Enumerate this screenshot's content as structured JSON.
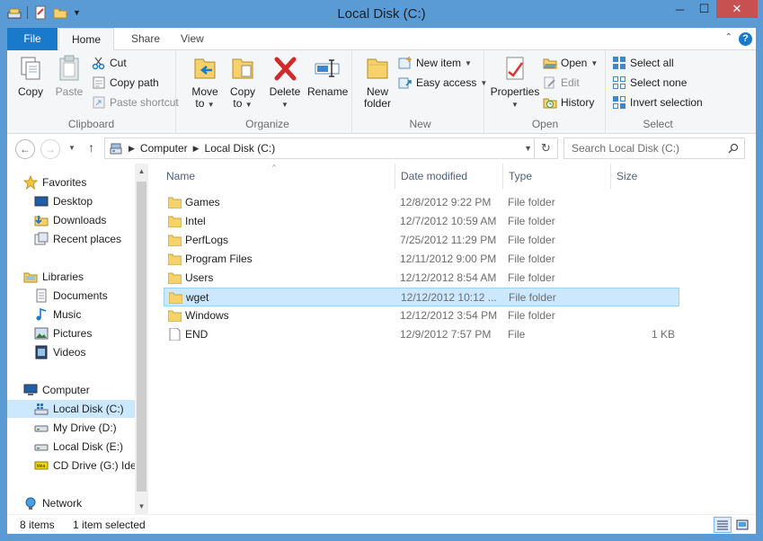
{
  "window": {
    "title": "Local Disk (C:)"
  },
  "ribbon_tabs": {
    "file": "File",
    "home": "Home",
    "share": "Share",
    "view": "View"
  },
  "clipboard": {
    "copy": "Copy",
    "paste": "Paste",
    "cut": "Cut",
    "copy_path": "Copy path",
    "paste_shortcut": "Paste shortcut",
    "label": "Clipboard"
  },
  "organize": {
    "move_to": "Move",
    "move_to_2": "to",
    "copy_to": "Copy",
    "copy_to_2": "to",
    "delete": "Delete",
    "rename": "Rename",
    "label": "Organize"
  },
  "new_group": {
    "new_folder": "New",
    "new_folder_2": "folder",
    "new_item": "New item",
    "easy_access": "Easy access",
    "label": "New"
  },
  "open_group": {
    "properties": "Properties",
    "open": "Open",
    "edit": "Edit",
    "history": "History",
    "label": "Open"
  },
  "select_group": {
    "select_all": "Select all",
    "select_none": "Select none",
    "invert_selection": "Invert selection",
    "label": "Select"
  },
  "address": {
    "computer": "Computer",
    "drive": "Local Disk (C:)"
  },
  "search": {
    "placeholder": "Search Local Disk (C:)"
  },
  "nav_pane": {
    "favorites": "Favorites",
    "desktop": "Desktop",
    "downloads": "Downloads",
    "recent_places": "Recent places",
    "libraries": "Libraries",
    "documents": "Documents",
    "music": "Music",
    "pictures": "Pictures",
    "videos": "Videos",
    "computer": "Computer",
    "local_disk_c": "Local Disk (C:)",
    "my_drive_d": "My Drive (D:)",
    "local_disk_e": "Local Disk (E:)",
    "cd_drive_g": "CD Drive (G:) Idea",
    "network": "Network"
  },
  "columns": {
    "name": "Name",
    "date": "Date modified",
    "type": "Type",
    "size": "Size"
  },
  "files": [
    {
      "name": "Games",
      "date": "12/8/2012 9:22 PM",
      "type": "File folder",
      "size": ""
    },
    {
      "name": "Intel",
      "date": "12/7/2012 10:59 AM",
      "type": "File folder",
      "size": ""
    },
    {
      "name": "PerfLogs",
      "date": "7/25/2012 11:29 PM",
      "type": "File folder",
      "size": ""
    },
    {
      "name": "Program Files",
      "date": "12/11/2012 9:00 PM",
      "type": "File folder",
      "size": ""
    },
    {
      "name": "Users",
      "date": "12/12/2012 8:54 AM",
      "type": "File folder",
      "size": ""
    },
    {
      "name": "wget",
      "date": "12/12/2012 10:12 ...",
      "type": "File folder",
      "size": ""
    },
    {
      "name": "Windows",
      "date": "12/12/2012 3:54 PM",
      "type": "File folder",
      "size": ""
    },
    {
      "name": "END",
      "date": "12/9/2012 7:57 PM",
      "type": "File",
      "size": "1 KB"
    }
  ],
  "status": {
    "count": "8 items",
    "selected": "1 item selected"
  }
}
